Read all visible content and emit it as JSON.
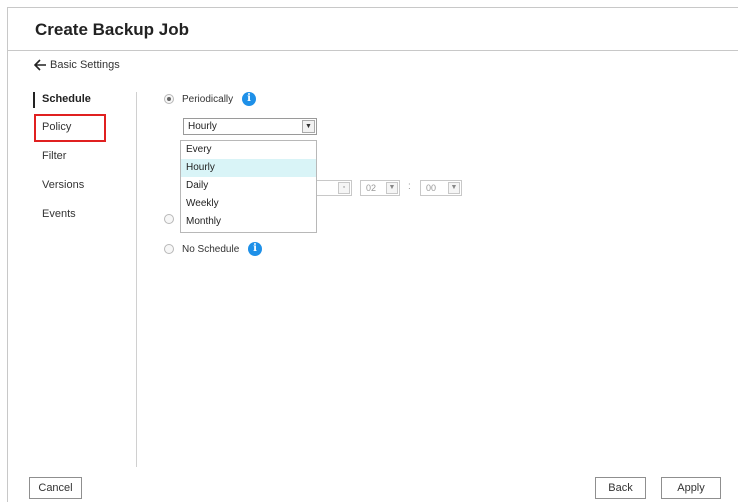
{
  "window": {
    "title": "Create Backup Job"
  },
  "back": {
    "label": "Basic Settings",
    "icon": "arrow-left-icon"
  },
  "sidebar": {
    "items": [
      {
        "label": "Schedule",
        "active": true
      },
      {
        "label": "Policy",
        "highlighted": true
      },
      {
        "label": "Filter"
      },
      {
        "label": "Versions"
      },
      {
        "label": "Events"
      }
    ]
  },
  "schedule": {
    "periodically": {
      "label": "Periodically",
      "selected": true,
      "icon": "info-icon"
    },
    "frequency_select": {
      "value": "Hourly",
      "options": [
        "Every",
        "Hourly",
        "Daily",
        "Weekly",
        "Monthly"
      ],
      "highlighted_option": "Hourly"
    },
    "time": {
      "hour": "02",
      "minute": "00",
      "separator": ":"
    },
    "no_schedule": {
      "label": "No Schedule",
      "selected": false,
      "icon": "info-icon"
    }
  },
  "footer": {
    "cancel_label": "Cancel",
    "back_label": "Back",
    "apply_label": "Apply"
  },
  "colors": {
    "accent": "#1e90e8",
    "highlight_box": "#e02020",
    "dropdown_hover": "#d9f4f7"
  }
}
